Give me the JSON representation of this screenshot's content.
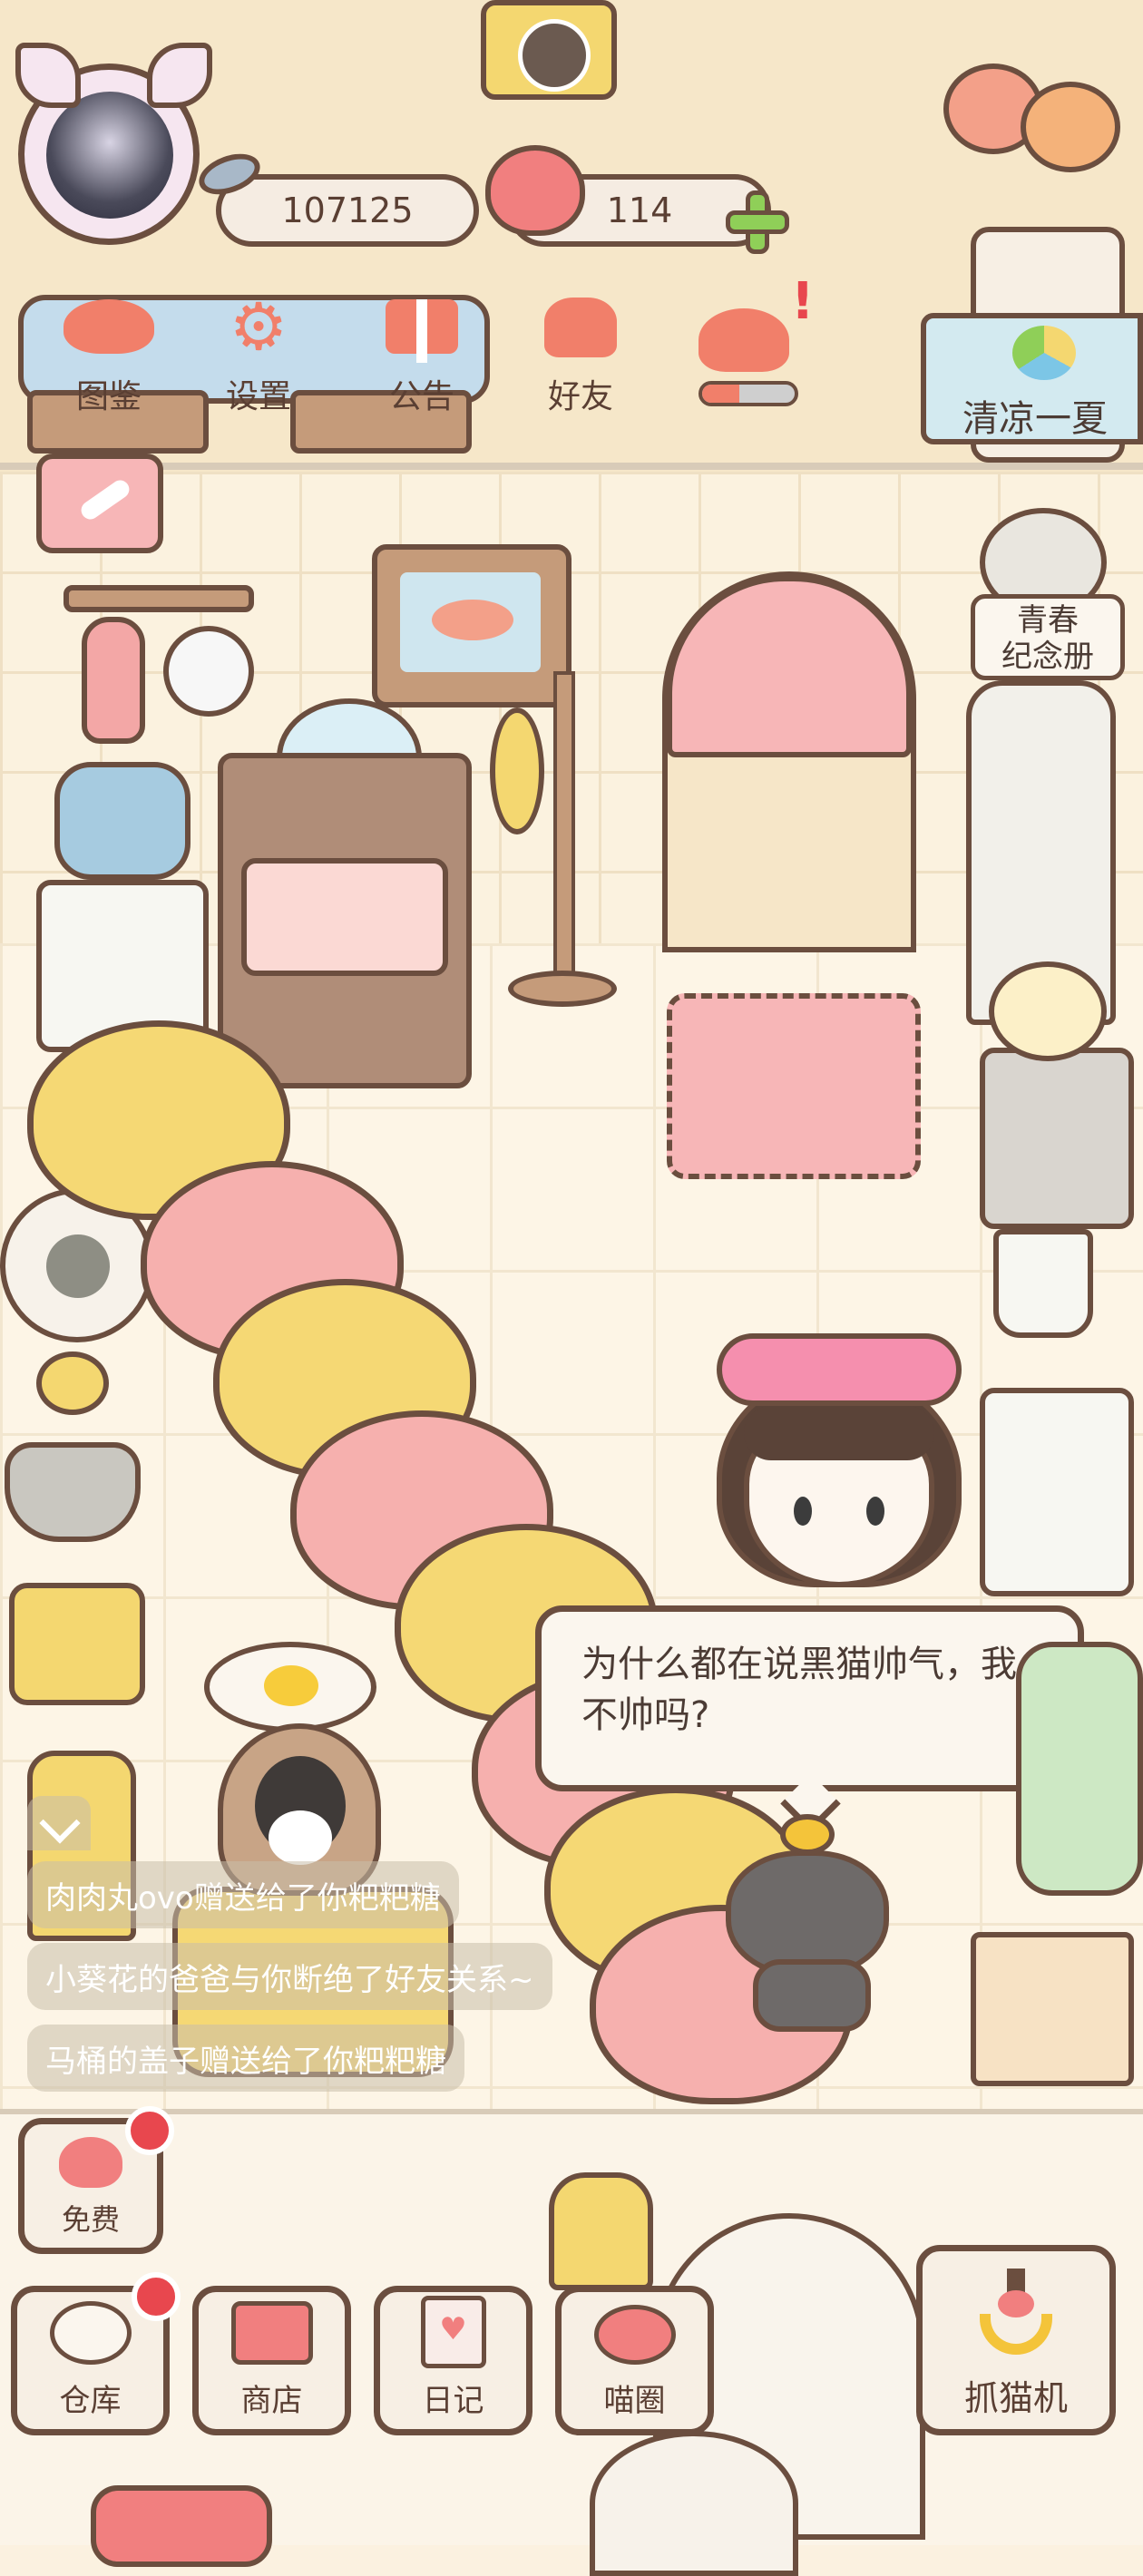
{
  "player": {
    "coins": "107125",
    "hearts": "114"
  },
  "top_menu": {
    "collection": "图鉴",
    "settings": "设置",
    "announcement": "公告",
    "friends": "好友"
  },
  "event_banner": "清凉一夏",
  "album": "青春\n纪念册",
  "speech_bubble": "为什么都在说黑猫帅气，我不帅吗?",
  "notices": [
    "肉肉丸ovo赠送给了你粑粑糖",
    "小葵花的爸爸与你断绝了好友关系~",
    "马桶的盖子赠送给了你粑粑糖"
  ],
  "bottom_menu": {
    "free": "免费",
    "warehouse": "仓库",
    "shop": "商店",
    "diary": "日记",
    "cat_circle": "喵圈",
    "claw_machine": "抓猫机"
  },
  "colors": {
    "outline": "#6b4e3f",
    "pink": "#f3a7a6",
    "yellow": "#f5d874",
    "red_dot": "#e8474e",
    "green_plus": "#8fcf58"
  }
}
